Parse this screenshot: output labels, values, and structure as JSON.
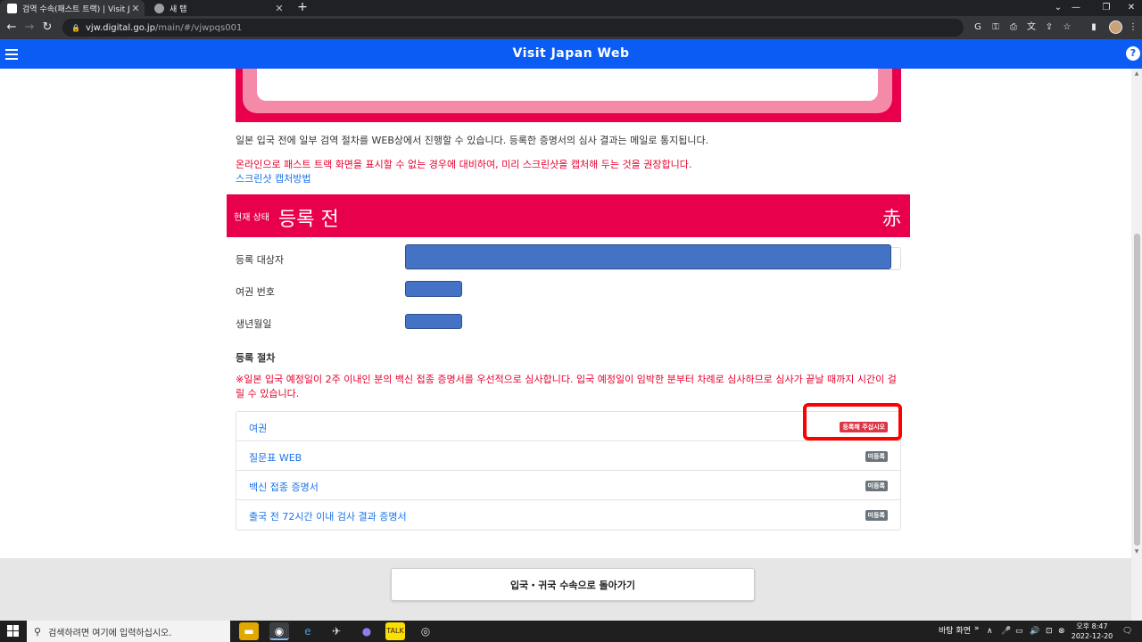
{
  "browser": {
    "tabs": [
      {
        "title": "검역 수속(패스트 트랙) | Visit Ja",
        "active": true
      },
      {
        "title": "새 탭",
        "active": false
      }
    ],
    "url_host": "vjw.digital.go.jp",
    "url_path": "/main/#/vjwpqs001"
  },
  "app": {
    "title": "Visit Japan Web",
    "header_color": "#0a5cf5"
  },
  "page": {
    "info_text": "일본 입국 전에 일부 검역 절차를 WEB상에서 진행할 수 있습니다. 등록한 증명서의 심사 결과는 메일로 통지됩니다.",
    "warning_text": "온라인으로 패스트 트랙 화면을 표시할 수 없는 경우에 대비하여, 미리 스크린샷을 캡처해 두는 것을 권장합니다.",
    "screenshot_link": "스크린샷 캡처방법",
    "status": {
      "label": "현재 상태",
      "value": "등록 전",
      "kanji": "赤",
      "color": "#e8004c"
    },
    "fields": [
      {
        "label": "등록 대상자"
      },
      {
        "label": "여권 번호"
      },
      {
        "label": "생년월일"
      }
    ],
    "procedures_title": "등록 절차",
    "procedures_notice": "※일본 입국 예정일이 2주 이내인 분의 백신 접종 증명서를 우선적으로 심사합니다. 입국 예정일이 임박한 분부터 차례로 심사하므로 심사가 끝날 때까지 시간이 걸릴 수 있습니다.",
    "procedures": [
      {
        "name": "여권",
        "badge": "등록해 주십시오",
        "badge_style": "red"
      },
      {
        "name": "질문표 WEB",
        "badge": "미등록",
        "badge_style": "gray"
      },
      {
        "name": "백신 접종 증명서",
        "badge": "미등록",
        "badge_style": "gray"
      },
      {
        "name": "출국 전 72시간 이내 검사 결과 증명서",
        "badge": "미등록",
        "badge_style": "gray"
      }
    ],
    "back_button": "입국・귀국 수속으로 돌아가기"
  },
  "taskbar": {
    "search_placeholder": "검색하려면 여기에 입력하십시오.",
    "desktop_label": "바탕 화면",
    "time": "오후 8:47",
    "date": "2022-12-20"
  }
}
